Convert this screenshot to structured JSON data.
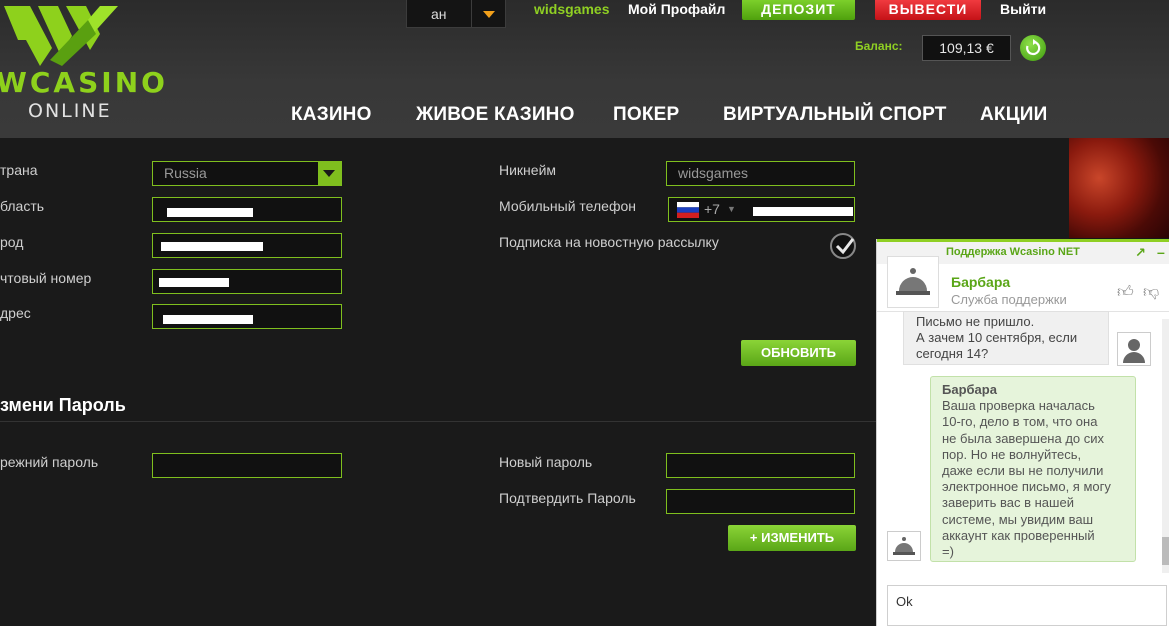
{
  "header": {
    "logo_text": "WCASINO",
    "logo_sub": "ONLINE",
    "lang_value": "ан",
    "username": "widsgames",
    "profile_label": "Мой Профайл",
    "deposit_label": "ДЕПОЗИТ",
    "withdraw_label": "ВЫВЕСТИ",
    "logout_label": "Выйти",
    "balance_label": "Баланс:",
    "balance_value": "109,13 €"
  },
  "nav": [
    "КАЗИНО",
    "ЖИВОЕ КАЗИНО",
    "ПОКЕР",
    "ВИРТУАЛЬНЫЙ СПОРТ",
    "АКЦИИ"
  ],
  "profile": {
    "country_label": "трана",
    "country_value": "Russia",
    "region_label": "бласть",
    "city_label": "род",
    "postal_label": "чтовый номер",
    "address_label": "дрес",
    "nickname_label": "Никнейм",
    "nickname_value": "widsgames",
    "phone_label": "Мобильный телефон",
    "phone_code": "+7",
    "newsletter_label": "Подписка на новостную рассылку",
    "update_label": "ОБНОВИТЬ"
  },
  "password": {
    "title": "змени Пароль",
    "old_label": "режний пароль",
    "new_label": "Новый пароль",
    "confirm_label": "Подтвердить Пароль",
    "change_label": "+ ИЗМЕНИТЬ"
  },
  "chat": {
    "title": "Поддержка Wcasino NET",
    "agent_name": "Барбара",
    "agent_role": "Служба поддержки",
    "user_message": [
      "Письмо не пришло.",
      "А зачем 10 сентября, если",
      "сегодня 14?"
    ],
    "agent_message_name": "Барбара",
    "agent_message": [
      "Ваша проверка началась",
      "10-го, дело в том, что она",
      "не была завершена до сих",
      "пор. Но не волнуйтесь,",
      "даже если вы не получили",
      "электронное письмо, я могу",
      "заверить вас в нашей",
      "системе, мы увидим ваш",
      "аккаунт как проверенный",
      "=)"
    ],
    "input_value": "Ok"
  },
  "colors": {
    "accent_green": "#8fcf23",
    "deposit": "#5aa617",
    "withdraw": "#d8181e",
    "refresh": "#4fa10d"
  }
}
